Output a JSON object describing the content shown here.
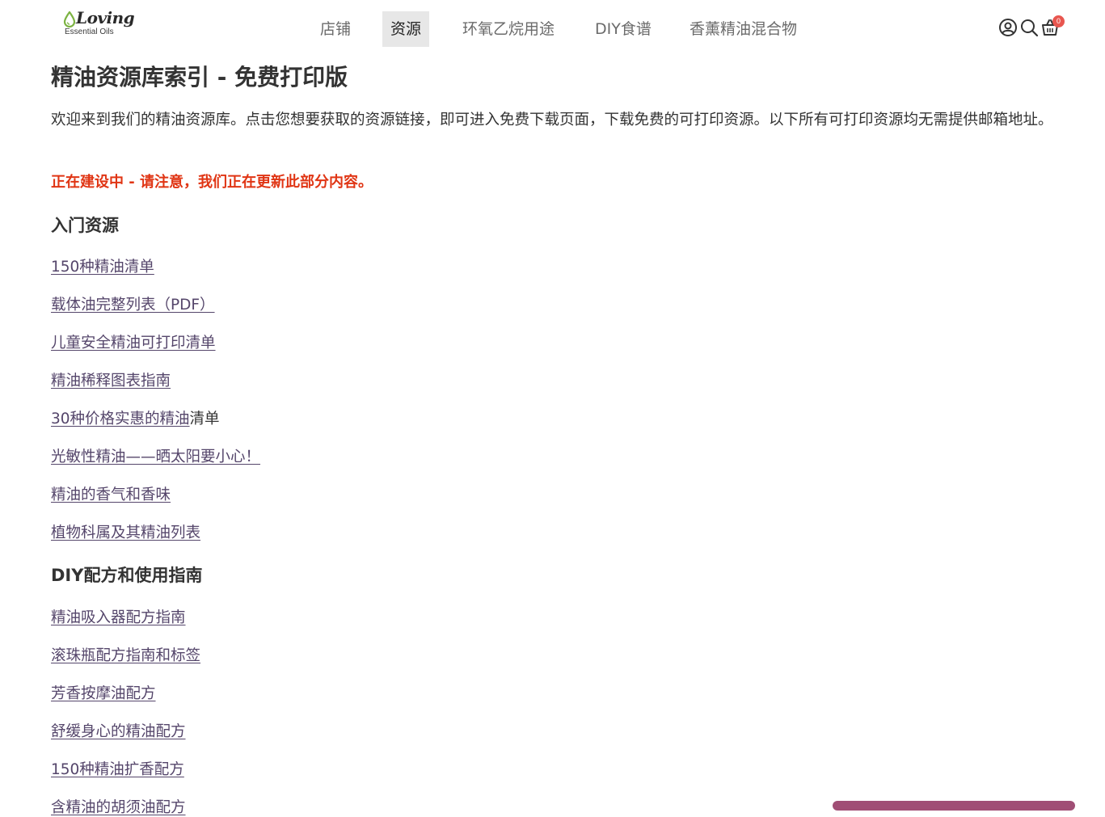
{
  "header": {
    "logo": {
      "word": "Loving",
      "sub": "Essential Oils"
    },
    "nav": [
      {
        "label": "店铺"
      },
      {
        "label": "资源"
      },
      {
        "label": "环氧乙烷用途"
      },
      {
        "label": "DIY食谱"
      },
      {
        "label": "香薰精油混合物"
      }
    ],
    "active_nav": "资源",
    "cart_count": "0",
    "icons": [
      "account-icon",
      "search-icon",
      "cart-icon"
    ]
  },
  "main": {
    "title": "精油资源库索引 - 免费打印版",
    "intro": "欢迎来到我们的精油资源库。点击您想要获取的资源链接，即可进入免费下载页面，下载免费的可打印资源。以下所有可打印资源均无需提供邮箱地址。",
    "notice": "正在建设中 - 请注意，我们正在更新此部分内容。",
    "sections": [
      {
        "heading": "入门资源",
        "links": [
          {
            "label": "150种精油清单"
          },
          {
            "label": "载体油完整列表（PDF）"
          },
          {
            "label": "儿童安全精油可打印清单"
          },
          {
            "label": "精油稀释图表指南"
          },
          {
            "label": "30种价格实惠的精油",
            "tail": "清单"
          },
          {
            "label": "光敏性精油——晒太阳要小心！"
          },
          {
            "label": "精油的香气和香味"
          },
          {
            "label": "植物科属及其精油列表"
          }
        ]
      },
      {
        "heading": "DIY配方和使用指南",
        "links": [
          {
            "label": "精油吸入器配方指南"
          },
          {
            "label": "滚珠瓶配方指南和标签"
          },
          {
            "label": "芳香按摩油配方"
          },
          {
            "label": "舒缓身心的精油配方"
          },
          {
            "label": "150种精油扩香配方"
          },
          {
            "label": "含精油的胡须油配方"
          }
        ]
      }
    ]
  },
  "colors": {
    "link": "#55466b",
    "notice": "#e03514",
    "text": "#333333",
    "nav_active_bg": "#e7e7e7",
    "badge": "#e8564f",
    "logo_drop": "#7cb342"
  }
}
